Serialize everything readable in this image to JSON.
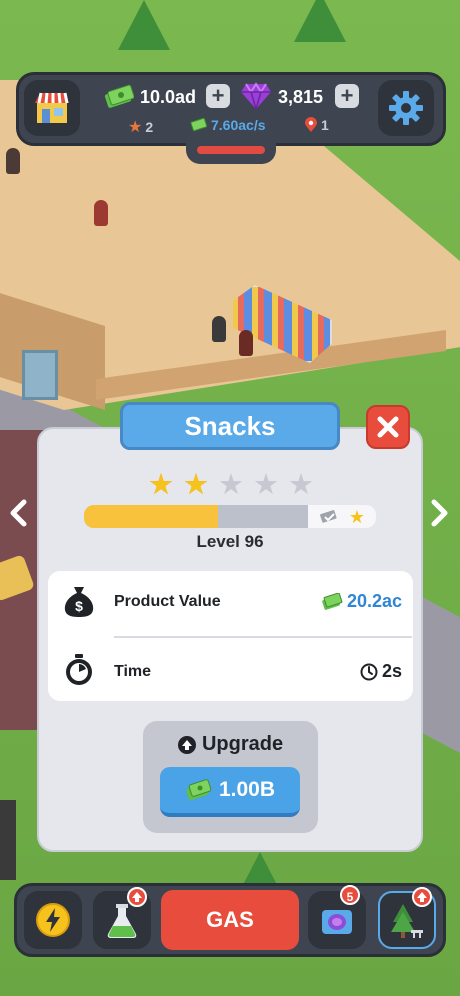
{
  "hud": {
    "cash": "10.0ad",
    "gems": "3,815",
    "stars": "2",
    "income": "7.60ac/s",
    "locations": "1",
    "plus_label": "+"
  },
  "panel": {
    "title": "Snacks",
    "stars_filled": 2,
    "stars_total": 5,
    "progress_fraction": 0.6,
    "level": "Level 96",
    "product_value_label": "Product Value",
    "product_value": "20.2ac",
    "time_label": "Time",
    "time_value": "2s",
    "upgrade_label": "Upgrade",
    "upgrade_cost": "1.00B"
  },
  "bottom": {
    "gas_label": "GAS",
    "portal_badge": "5"
  },
  "colors": {
    "hud_bg": "#3e4450",
    "accent_blue": "#4aa3e6",
    "accent_red": "#e84c3d",
    "star_gold": "#f6c21c",
    "progress_fill": "#f8c23d",
    "value_blue": "#2f86d6"
  },
  "icons": {
    "shop": "shop-icon",
    "cash": "cash-icon",
    "gem": "gem-icon",
    "settings": "gear-icon",
    "star": "star-icon",
    "location": "location-pin-icon",
    "money_bag": "money-bag-icon",
    "stopwatch": "stopwatch-icon",
    "clock": "clock-icon",
    "arrow_up": "arrow-up-circle-icon",
    "close": "close-icon",
    "boost": "lightning-icon",
    "research": "flask-icon",
    "portal": "portal-icon",
    "park": "tree-icon"
  }
}
